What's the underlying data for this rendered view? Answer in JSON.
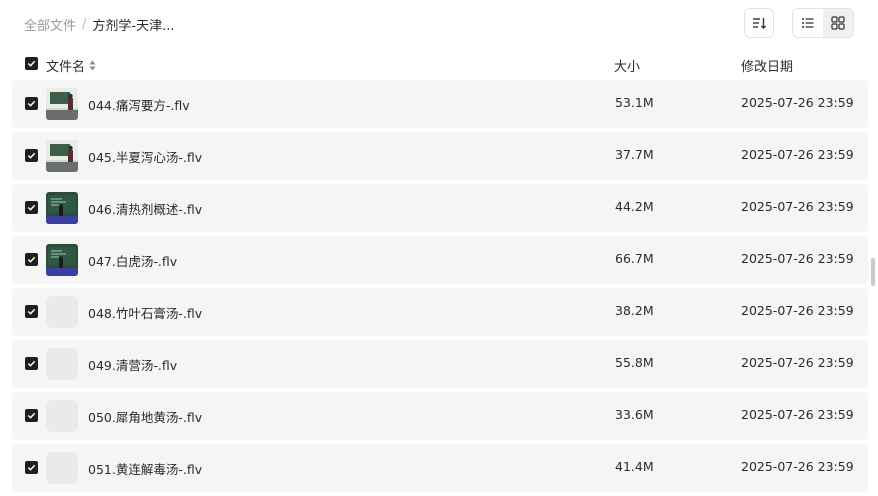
{
  "breadcrumb": {
    "root": "全部文件",
    "separator": "/",
    "current": "方剂学-天津..."
  },
  "columns": {
    "name": "文件名",
    "size": "大小",
    "modified": "修改日期"
  },
  "files": [
    {
      "name": "044.痛泻要方-.flv",
      "size": "53.1M",
      "modified": "2025-07-26 23:59",
      "checked": true,
      "thumbnail": "video-lecture-teacher"
    },
    {
      "name": "045.半夏泻心汤-.flv",
      "size": "37.7M",
      "modified": "2025-07-26 23:59",
      "checked": true,
      "thumbnail": "video-lecture-teacher"
    },
    {
      "name": "046.清热剂概述-.flv",
      "size": "44.2M",
      "modified": "2025-07-26 23:59",
      "checked": true,
      "thumbnail": "video-lecture-blackboard"
    },
    {
      "name": "047.白虎汤-.flv",
      "size": "66.7M",
      "modified": "2025-07-26 23:59",
      "checked": true,
      "thumbnail": "video-lecture-blackboard"
    },
    {
      "name": "048.竹叶石膏汤-.flv",
      "size": "38.2M",
      "modified": "2025-07-26 23:59",
      "checked": true,
      "thumbnail": "placeholder"
    },
    {
      "name": "049.清营汤-.flv",
      "size": "55.8M",
      "modified": "2025-07-26 23:59",
      "checked": true,
      "thumbnail": "placeholder"
    },
    {
      "name": "050.犀角地黄汤-.flv",
      "size": "33.6M",
      "modified": "2025-07-26 23:59",
      "checked": true,
      "thumbnail": "placeholder"
    },
    {
      "name": "051.黄连解毒汤-.flv",
      "size": "41.4M",
      "modified": "2025-07-26 23:59",
      "checked": true,
      "thumbnail": "placeholder"
    }
  ],
  "colors": {
    "row_bg": "#f5f5f6",
    "checkbox": "#1f1f1f",
    "muted_text": "#9a9a9a"
  },
  "toolbar": {
    "sort_icon": "sort-icon",
    "list_view_icon": "list-view-icon",
    "grid_view_icon": "grid-view-icon",
    "active_view": "list"
  }
}
